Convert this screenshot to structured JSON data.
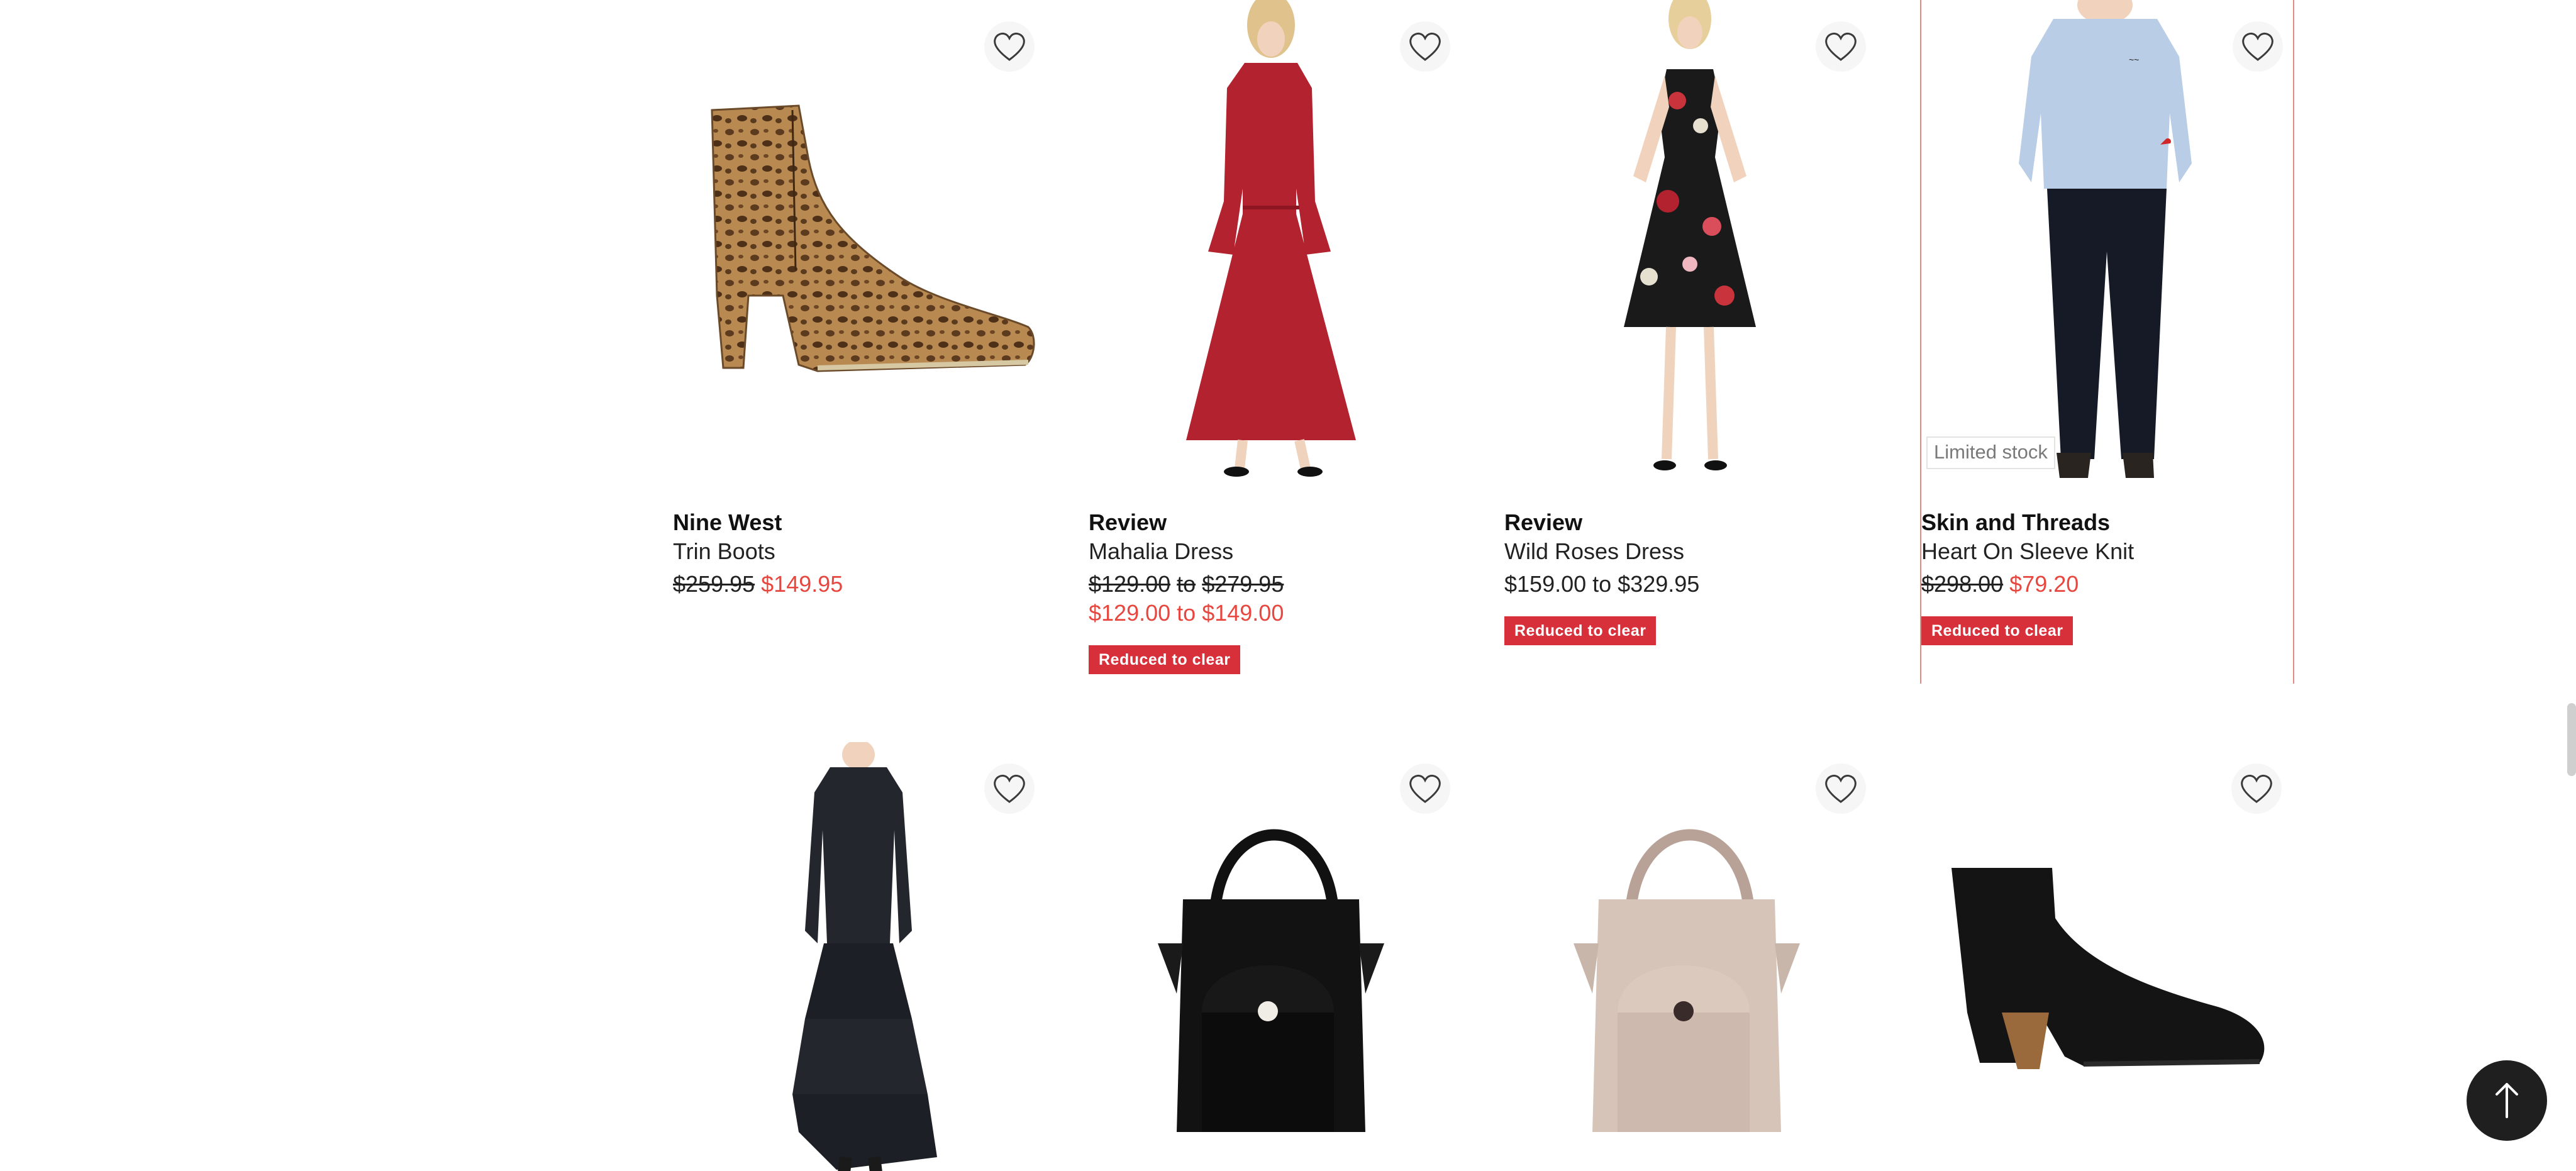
{
  "colors": {
    "accent_red": "#d8303a",
    "sale_price": "#e8473f",
    "highlight_border": "#e28a84"
  },
  "products": [
    {
      "brand": "Nine West",
      "name": "Trin Boots",
      "was_price": "$259.95",
      "now_price": "$149.95",
      "image": "leopard-ankle-boot",
      "heart_icon": "heart-outline-icon"
    },
    {
      "brand": "Review",
      "name": "Mahalia Dress",
      "was_price_from": "$129.00",
      "was_price_sep": "to",
      "was_price_to": "$279.95",
      "now_price_from": "$129.00",
      "now_price_sep": "to",
      "now_price_to": "$149.00",
      "badge": "Reduced to clear",
      "image": "red-midi-dress",
      "heart_icon": "heart-outline-icon"
    },
    {
      "brand": "Review",
      "name": "Wild Roses Dress",
      "price_range": "$159.00 to $329.95",
      "badge": "Reduced to clear",
      "image": "floral-black-dress",
      "heart_icon": "heart-outline-icon"
    },
    {
      "brand": "Skin and Threads",
      "name": "Heart On Sleeve Knit",
      "was_price": "$298.00",
      "now_price": "$79.20",
      "stock_badge": "Limited stock",
      "badge": "Reduced to clear",
      "image": "blue-knit-sweater",
      "heart_icon": "heart-outline-icon"
    },
    {
      "image": "black-tiered-dress",
      "heart_icon": "heart-outline-icon"
    },
    {
      "image": "black-tote-bag",
      "heart_icon": "heart-outline-icon"
    },
    {
      "image": "beige-tote-bag",
      "heart_icon": "heart-outline-icon"
    },
    {
      "image": "black-western-boot",
      "heart_icon": "heart-outline-icon"
    }
  ],
  "back_to_top_icon": "arrow-up-icon"
}
